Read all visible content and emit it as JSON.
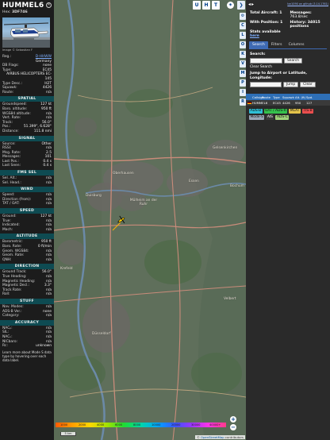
{
  "aircraft": {
    "callsign": "HUMMEL6",
    "hex_label": "Hex:",
    "hex": "3DF746",
    "photo_credit": "Image © Sebastian F",
    "reg_label": "Reg.:",
    "reg": "D-HHWW",
    "country": "Germany",
    "db_flags_label": "DB Flags:",
    "db_flags": "none",
    "type_label": "Type:",
    "type": "EC45",
    "type_name": "AIRBUS HELICOPTERS EC-145",
    "typedesc_label": "Type Desc.:",
    "typedesc": "H2T",
    "squawk_label": "Squawk:",
    "squawk": "4426",
    "route_label": "Route:",
    "route": "n/a"
  },
  "sections": {
    "spatial": "SPATIAL",
    "signal": "SIGNAL",
    "fms": "FMS SEL",
    "wind": "WIND",
    "speed": "SPEED",
    "altitude": "ALTITUDE",
    "direction": "DIRECTION",
    "stuff": "STUFF",
    "accuracy": "ACCURACY"
  },
  "spatial": [
    {
      "k": "Groundspeed:",
      "v": "127 kt"
    },
    {
      "k": "Baro. altitude:",
      "v": "950 ft"
    },
    {
      "k": "WGS84 altitude:",
      "v": "n/a"
    },
    {
      "k": "Vert. Rate:",
      "v": "n/a"
    },
    {
      "k": "Track:",
      "v": "56.0°"
    },
    {
      "k": "Pos.:",
      "v": "51.399°, 6.628°"
    },
    {
      "k": "Distance:",
      "v": "111.8 nmi"
    }
  ],
  "signal": [
    {
      "k": "Source:",
      "v": "Other"
    },
    {
      "k": "RSSI:",
      "v": "n/a"
    },
    {
      "k": "Msg. Rate:",
      "v": "2.5"
    },
    {
      "k": "Messages:",
      "v": "101"
    },
    {
      "k": "Last Pos.:",
      "v": "0.4 s"
    },
    {
      "k": "Last Seen:",
      "v": "0.4 s"
    }
  ],
  "fms": [
    {
      "k": "Sel. Alt.:",
      "v": "n/a"
    },
    {
      "k": "Sel. Head.:",
      "v": "n/a"
    }
  ],
  "wind": [
    {
      "k": "Speed:",
      "v": "n/a"
    },
    {
      "k": "Direction (from):",
      "v": "n/a"
    },
    {
      "k": "TAT / OAT:",
      "v": "n/a"
    }
  ],
  "speed": [
    {
      "k": "Ground:",
      "v": "127 kt"
    },
    {
      "k": "True:",
      "v": "n/a"
    },
    {
      "k": "Indicated:",
      "v": "n/a"
    },
    {
      "k": "Mach:",
      "v": "n/a"
    }
  ],
  "altitude": [
    {
      "k": "Barometric:",
      "v": "950 ft"
    },
    {
      "k": "Baro. Rate:",
      "v": "0 ft/min"
    },
    {
      "k": "Geom. WGS84:",
      "v": "n/a"
    },
    {
      "k": "Geom. Rate:",
      "v": "n/a"
    },
    {
      "k": "QNH:",
      "v": "n/a"
    }
  ],
  "direction": [
    {
      "k": "Ground Track:",
      "v": "56.0°"
    },
    {
      "k": "True Heading:",
      "v": "n/a"
    },
    {
      "k": "Magnetic Heading:",
      "v": "n/a"
    },
    {
      "k": "Magnetic Decl.:",
      "v": "3.3°"
    },
    {
      "k": "Track Rate:",
      "v": "n/a"
    },
    {
      "k": "Roll:",
      "v": "n/a"
    }
  ],
  "stuff": [
    {
      "k": "Nav. Modes:",
      "v": "n/a"
    },
    {
      "k": "ADS-B Ver.:",
      "v": "none"
    },
    {
      "k": "Category:",
      "v": "n/a"
    }
  ],
  "accuracy": [
    {
      "k": "NACₚ:",
      "v": "n/a"
    },
    {
      "k": "SIL:",
      "v": "n/a"
    },
    {
      "k": "NACᵥ:",
      "v": "n/a"
    },
    {
      "k": "NICbaro:",
      "v": "n/a"
    },
    {
      "k": "Rc:",
      "v": "unknown"
    }
  ],
  "footer": {
    "text": "Learn more about Mode S data type by hovering over each data label."
  },
  "map": {
    "buttons": [
      "U",
      "H",
      "T"
    ],
    "side_buttons": [
      "C",
      "L",
      "O",
      "K",
      "V",
      "M",
      "P",
      "I",
      "R"
    ],
    "cities": [
      {
        "name": "Oberhausen"
      },
      {
        "name": "Essen"
      },
      {
        "name": "Gelsenkirchen"
      },
      {
        "name": "Mülheim an der Ruhr"
      },
      {
        "name": "Duisburg"
      },
      {
        "name": "Bochum"
      },
      {
        "name": "Düsseldorf"
      },
      {
        "name": "Krefeld"
      },
      {
        "name": "Velbert"
      }
    ],
    "alt_labels": [
      "1000",
      "2000",
      "4000",
      "6000",
      "8000",
      "10000",
      "20000",
      "30000",
      "40000+"
    ],
    "scale": "5 km",
    "attribution_prefix": "© ",
    "attribution_link": "OpenStreetMap",
    "attribution_suffix": " contributors",
    "zoom_in": "+",
    "zoom_out": "−"
  },
  "sidebar": {
    "version": "tar1090 on github (3.14.1761)",
    "total_label": "Total Aircraft: 1",
    "messages_label": "Messages:",
    "messages_value": "763.8/sec",
    "with_pos_label": "With Position: 1",
    "history_label": "History: 34015 positions",
    "stats_label": "Stats available",
    "stats_link": "here",
    "tabs": [
      "Search",
      "Filters",
      "Columns"
    ],
    "search_label": "Search:",
    "search_button": "Search",
    "clear_search": "Clear Search",
    "jump_label": "Jump to Airport or Latitude, Longitude:",
    "jump_button": "Jump",
    "clear_button": "Clear",
    "table_headers": [
      "",
      "Callsign",
      "Route",
      "Type",
      "Squawk",
      "Alt. (ft)",
      "Spd."
    ],
    "table_row": {
      "callsign": "HUMMEL6",
      "type": "EC45",
      "squawk": "4426",
      "alt": "950",
      "spd": "127"
    },
    "badges": [
      {
        "label": "ADS-B",
        "color": "#2fbfd6"
      },
      {
        "label": "UAT / ADS-R",
        "color": "#35c24d"
      },
      {
        "label": "MLAT",
        "color": "#e3c24a"
      },
      {
        "label": "TIS-B",
        "color": "#e94e4e"
      },
      {
        "label": "Mode-S",
        "color": "#9aa6b6"
      },
      {
        "label": "AIS",
        "color": "#3a3a3a"
      },
      {
        "label": "ADS-C",
        "color": "#9fd27a"
      }
    ]
  }
}
